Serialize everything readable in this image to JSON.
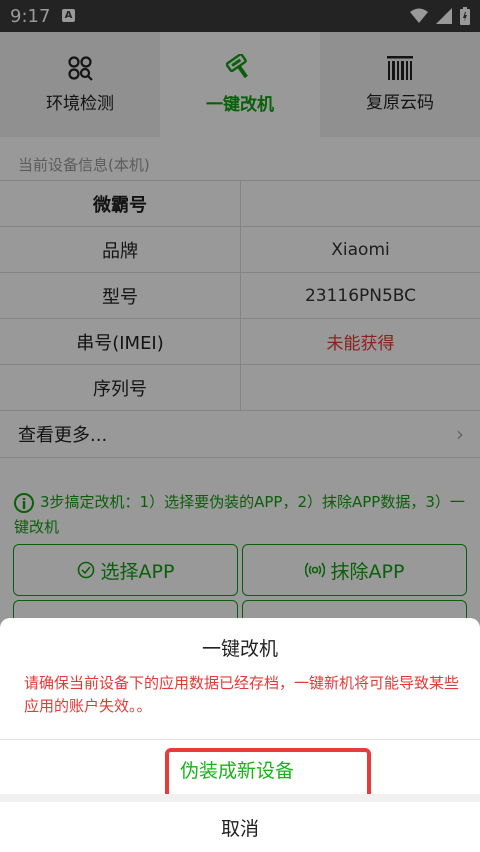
{
  "status_bar": {
    "time": "9:17",
    "app_icon": "A",
    "icons": [
      "wifi-icon",
      "signal-icon",
      "battery-icon"
    ]
  },
  "tabs": [
    {
      "label": "环境检测",
      "icon": "env-check-icon",
      "active": false
    },
    {
      "label": "一键改机",
      "icon": "paint-roller-icon",
      "active": true
    },
    {
      "label": "复原云码",
      "icon": "barcode-icon",
      "active": false
    }
  ],
  "device_info": {
    "section_title": "当前设备信息(本机)",
    "header": "微霸号",
    "rows": [
      {
        "key": "品牌",
        "value": "Xiaomi"
      },
      {
        "key": "型号",
        "value": "23116PN5BC"
      },
      {
        "key": "串号(IMEI)",
        "value": "未能获得"
      },
      {
        "key": "序列号",
        "value": ""
      }
    ],
    "more_label": "查看更多..."
  },
  "tip": {
    "text": "3步搞定改机：1）选择要伪装的APP，2）抹除APP数据，3）一键改机"
  },
  "buttons": {
    "select_app": "选择APP",
    "erase_app": "抹除APP"
  },
  "dialog": {
    "title": "一键改机",
    "message": "请确保当前设备下的应用数据已经存档，一键新机将可能导致某些应用的账户失效。。",
    "action": "伪装成新设备",
    "cancel": "取消"
  },
  "colors": {
    "accent_green": "#12a012",
    "warning_red": "#e53935",
    "highlight_red": "#e83b3b"
  }
}
